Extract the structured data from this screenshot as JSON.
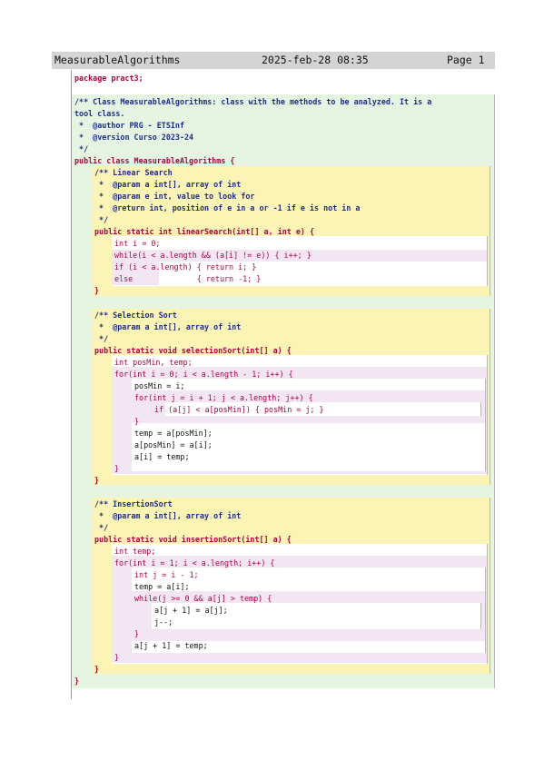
{
  "header": {
    "file_name": "MeasurableAlgorithms",
    "date_time": "2025-feb-28 08:35",
    "page_label": "Page 1"
  },
  "code": {
    "l01": "package pract3;",
    "l02": "/** Class MeasurableAlgorithms: class with the methods to be analyzed. It is a",
    "l03": "tool class.",
    "l04": " *  @author PRG - ETSInf",
    "l05": " *  @version Curso 2023-24",
    "l06": " */",
    "l07": "public class MeasurableAlgorithms {",
    "l08": "/** Linear Search",
    "l09": " *  @param a int[], array of int",
    "l10": " *  @param e int, value to look for",
    "l11": " *  @return int, position of e in a or -1 if e is not in a",
    "l12": " */",
    "l13": "public static int linearSearch(int[] a, int e) {",
    "l14": "int i = 0;",
    "l15": "while(i < a.length && (a[i] != e)) { i++; }",
    "l16": "if (i < a.length) { return i; }",
    "l17": "else              { return -1; }",
    "l18": "}",
    "l19": "/** Selection Sort",
    "l20": " *  @param a int[], array of int",
    "l21": " */",
    "l22": "public static void selectionSort(int[] a) {",
    "l23": "int posMin, temp;",
    "l24": "for(int i = 0; i < a.length - 1; i++) {",
    "l25": "posMin = i;",
    "l26": "for(int j = i + 1; j < a.length; j++) {",
    "l27": "if (a[j] < a[posMin]) { posMin = j; }",
    "l28": "}",
    "l29": "temp = a[posMin];",
    "l30": "a[posMin] = a[i];",
    "l31": "a[i] = temp;",
    "l32": "}",
    "l33": "}",
    "l34": "/** InsertionSort",
    "l35": " *  @param a int[], array of int",
    "l36": " */",
    "l37": "public static void insertionSort(int[] a) {",
    "l38": "int temp;",
    "l39": "for(int i = 1; i < a.length; i++) {",
    "l40": "int j = i - 1;",
    "l41": "temp = a[i];",
    "l42": "while(j >= 0 && a[j] > temp) {",
    "l43": "a[j + 1] = a[j];",
    "l44": "j--;",
    "l45": "}",
    "l46": "a[j + 1] = temp;",
    "l47": "}",
    "l48": "}",
    "l49": "}"
  },
  "colors": {
    "class_bg": "#e6f5e2",
    "method_bg": "#fbf4b5",
    "body_bg": "#ffffff",
    "loop_bg": "#f3e6f3",
    "keyword": "#b00040",
    "comment": "#1d2d8c"
  }
}
